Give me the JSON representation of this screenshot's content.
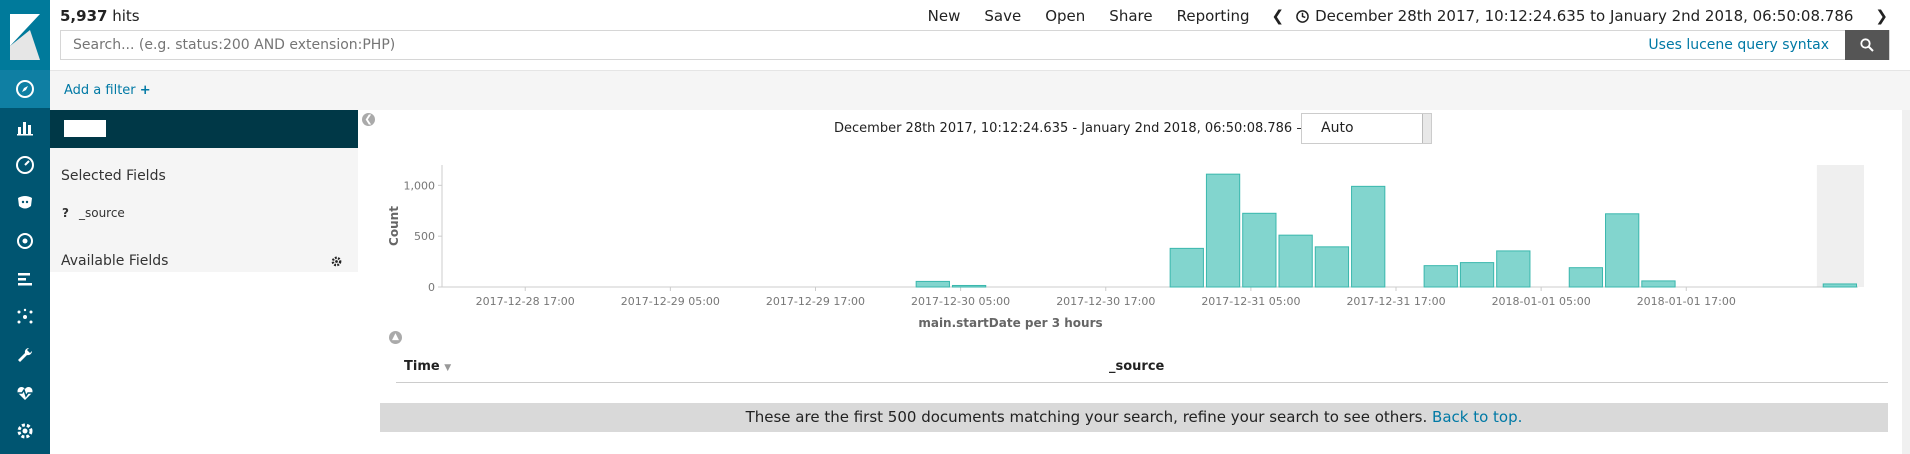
{
  "topbar": {
    "hits_count": "5,937",
    "hits_label": "hits",
    "menu": [
      "New",
      "Save",
      "Open",
      "Share",
      "Reporting"
    ],
    "time_range": "December 28th 2017, 10:12:24.635 to January 2nd 2018, 06:50:08.786"
  },
  "search": {
    "placeholder": "Search... (e.g. status:200 AND extension:PHP)",
    "lucene_link": "Uses lucene query syntax"
  },
  "filters": {
    "add_label": "Add a filter"
  },
  "sidebar": {
    "selected_title": "Selected Fields",
    "source_type": "?",
    "source_field": "_source",
    "available_title": "Available Fields"
  },
  "histogram": {
    "range_text": "December 28th 2017, 10:12:24.635 - January 2nd 2018, 06:50:08.786 —",
    "interval": "Auto"
  },
  "table": {
    "time_header": "Time",
    "source_header": "_source"
  },
  "footer": {
    "note": "These are the first 500 documents matching your search, refine your search to see others.",
    "link": "Back to top."
  },
  "nav_icons": [
    "discover-icon",
    "visualize-icon",
    "dashboard-icon",
    "timelion-icon",
    "machine-learning-icon",
    "apm-icon",
    "graph-icon",
    "dev-tools-icon",
    "monitoring-icon",
    "management-icon"
  ],
  "colors": {
    "rail": "#005571",
    "bar_fill": "#82d5ce",
    "bar_stroke": "#3ab7ad",
    "link": "#0079a5"
  },
  "chart_data": {
    "type": "bar",
    "xlabel": "main.startDate per 3 hours",
    "ylabel": "Count",
    "ylim": [
      0,
      1200
    ],
    "y_ticks": [
      0,
      500,
      1000
    ],
    "y_tick_labels": [
      "0",
      "500",
      "1,000"
    ],
    "x_tick_labels": [
      "2017-12-28 17:00",
      "2017-12-29 05:00",
      "2017-12-29 17:00",
      "2017-12-30 05:00",
      "2017-12-30 17:00",
      "2017-12-31 05:00",
      "2017-12-31 17:00",
      "2018-01-01 05:00",
      "2018-01-01 17:00"
    ],
    "x_tick_hours": [
      6.8,
      18.8,
      30.8,
      42.8,
      54.8,
      66.8,
      78.8,
      90.8,
      102.8
    ],
    "x_range_hours": [
      0,
      117
    ],
    "bars": [
      {
        "start": "2017-12-30 03:00",
        "hour": 39,
        "value": 55
      },
      {
        "start": "2017-12-30 06:00",
        "hour": 42,
        "value": 15
      },
      {
        "start": "2017-12-31 00:00",
        "hour": 60,
        "value": 380
      },
      {
        "start": "2017-12-31 03:00",
        "hour": 63,
        "value": 1110
      },
      {
        "start": "2017-12-31 06:00",
        "hour": 66,
        "value": 725
      },
      {
        "start": "2017-12-31 09:00",
        "hour": 69,
        "value": 510
      },
      {
        "start": "2017-12-31 12:00",
        "hour": 72,
        "value": 395
      },
      {
        "start": "2017-12-31 15:00",
        "hour": 75,
        "value": 990
      },
      {
        "start": "2017-12-31 21:00",
        "hour": 81,
        "value": 210
      },
      {
        "start": "2018-01-01 00:00",
        "hour": 84,
        "value": 240
      },
      {
        "start": "2018-01-01 03:00",
        "hour": 87,
        "value": 355
      },
      {
        "start": "2018-01-01 09:00",
        "hour": 93,
        "value": 190
      },
      {
        "start": "2018-01-01 12:00",
        "hour": 96,
        "value": 720
      },
      {
        "start": "2018-01-01 15:00",
        "hour": 99,
        "value": 60
      },
      {
        "start": "2018-01-02 06:00",
        "hour": 114,
        "value": 30
      }
    ]
  }
}
